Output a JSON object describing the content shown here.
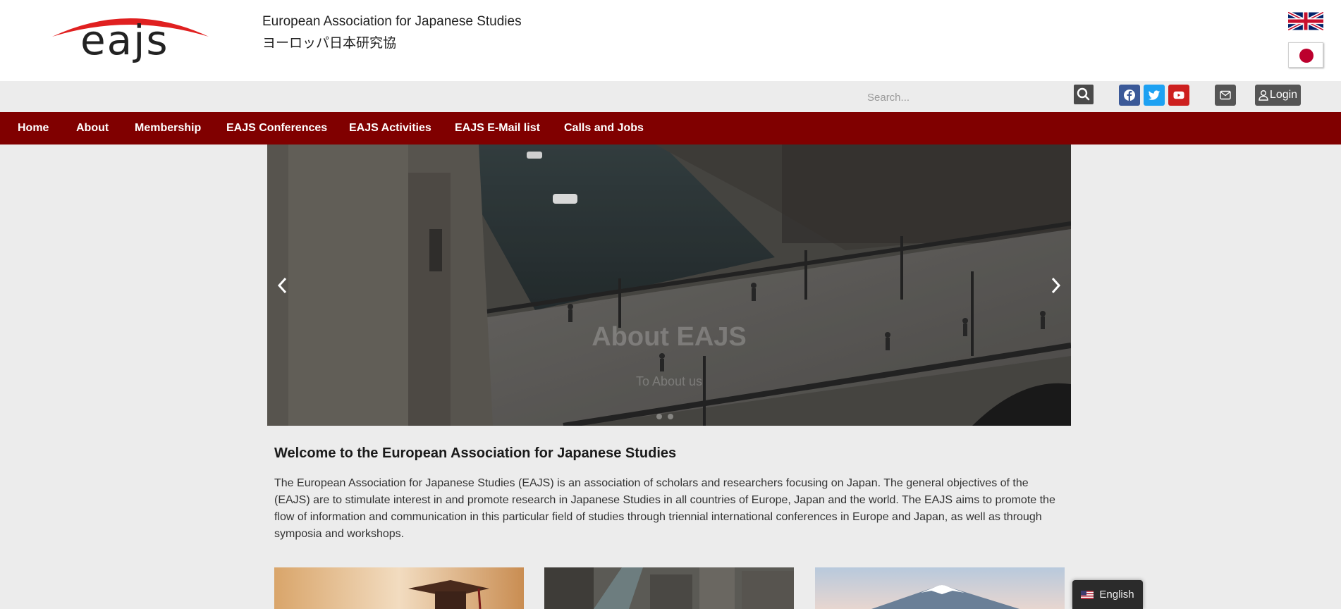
{
  "header": {
    "logo_text": "eajs",
    "site_name": "European Association for Japanese Studies",
    "site_name_jp": "ヨーロッパ日本研究協",
    "flags": [
      "uk-flag-icon",
      "japan-flag-icon"
    ]
  },
  "utility": {
    "search_placeholder": "Search...",
    "login_label": "Login",
    "social": [
      "facebook-icon",
      "twitter-icon",
      "youtube-icon"
    ]
  },
  "nav": {
    "items": [
      {
        "label": "Home"
      },
      {
        "label": "About"
      },
      {
        "label": "Membership"
      },
      {
        "label": "EAJS Conferences"
      },
      {
        "label": "EAJS Activities"
      },
      {
        "label": "EAJS E-Mail list"
      },
      {
        "label": "Calls and Jobs"
      }
    ]
  },
  "slider": {
    "title": "About EAJS",
    "subtitle": "To About us"
  },
  "main": {
    "heading": "Welcome to the European Association for Japanese Studies",
    "intro": "The European Association for Japanese Studies (EAJS) is an association of scholars and researchers focusing on Japan. The general objectives of the (EAJS) are to stimulate interest in and promote research in Japanese Studies in all countries of Europe, Japan and the world. The EAJS aims to promote the flow of information and communication in this particular field of studies through triennial international conferences in Europe and Japan, as well as through symposia and workshops."
  },
  "language": {
    "label": "English"
  },
  "colors": {
    "nav_bg": "#800000",
    "logo_arc": "#e02020",
    "facebook": "#3b5998",
    "twitter": "#1da1f2",
    "youtube": "#cd201f"
  }
}
